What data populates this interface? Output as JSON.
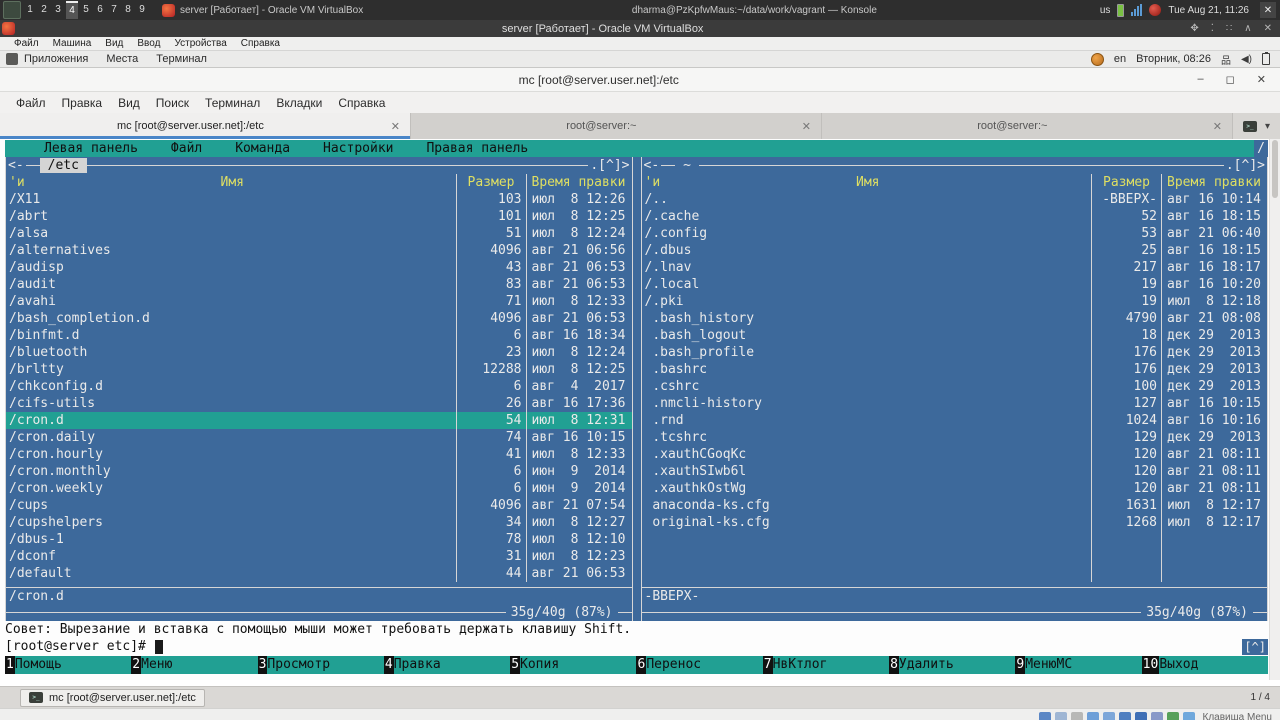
{
  "host_bar": {
    "workspaces": [
      {
        "n": "1"
      },
      {
        "n": "2"
      },
      {
        "n": "3"
      },
      {
        "n": "4",
        "active": true
      },
      {
        "n": "5"
      },
      {
        "n": "6"
      },
      {
        "n": "7"
      },
      {
        "n": "8"
      },
      {
        "n": "9"
      }
    ],
    "tasks": [
      {
        "label": "server [Работает] - Oracle VM VirtualBox"
      },
      {
        "label": "dharma@PzKpfwMaus:~/data/work/vagrant — Konsole"
      }
    ],
    "tray": {
      "layout": "us",
      "clock": "Tue Aug 21, 11:26",
      "close_glyph": "✕"
    }
  },
  "vbox": {
    "title": "server [Работает] - Oracle VM VirtualBox",
    "window_controls": [
      {
        "g": "✥"
      },
      {
        "g": "⁚"
      },
      {
        "g": "∷"
      },
      {
        "g": "∧"
      },
      {
        "g": "✕"
      }
    ],
    "menu": [
      {
        "label": "Файл"
      },
      {
        "label": "Машина"
      },
      {
        "label": "Вид"
      },
      {
        "label": "Ввод"
      },
      {
        "label": "Устройства"
      },
      {
        "label": "Справка"
      }
    ],
    "statusbar": {
      "icons": [
        {
          "name": "hdd",
          "color": "#5b87c5"
        },
        {
          "name": "cd",
          "color": "#9fb6d4"
        },
        {
          "name": "audio",
          "color": "#b8b8b6"
        },
        {
          "name": "network",
          "color": "#6d9fd8"
        },
        {
          "name": "usb",
          "color": "#7da7d9"
        },
        {
          "name": "shared-folders",
          "color": "#4f7fc0"
        },
        {
          "name": "display",
          "color": "#3f6fb5"
        },
        {
          "name": "recording",
          "color": "#8898c8"
        },
        {
          "name": "features",
          "color": "#57a05a"
        },
        {
          "name": "mouse",
          "color": "#6fa8dc"
        }
      ],
      "hostkey": "Клавиша Menu"
    }
  },
  "guest_panel": {
    "menus": [
      {
        "label": "Приложения"
      },
      {
        "label": "Места"
      },
      {
        "label": "Терминал"
      }
    ],
    "layout": "en",
    "clock": "Вторник, 08:26"
  },
  "terminal": {
    "title": "mc [root@server.user.net]:/etc",
    "controls": {
      "minimize": "–",
      "maximize": "◻",
      "close": "✕"
    },
    "menu": [
      {
        "label": "Файл"
      },
      {
        "label": "Правка"
      },
      {
        "label": "Вид"
      },
      {
        "label": "Поиск"
      },
      {
        "label": "Терминал"
      },
      {
        "label": "Вкладки"
      },
      {
        "label": "Справка"
      }
    ],
    "tabs": [
      {
        "label": "mc [root@server.user.net]:/etc",
        "close": "✕"
      },
      {
        "label": "root@server:~",
        "close": "✕"
      },
      {
        "label": "root@server:~",
        "close": "✕"
      }
    ],
    "new_tab_glyph": ">_",
    "tab_dropdown_glyph": "▾"
  },
  "mc": {
    "menubar": [
      {
        "label": "Левая панель"
      },
      {
        "label": "Файл"
      },
      {
        "label": "Команда"
      },
      {
        "label": "Настройки"
      },
      {
        "label": "Правая панель"
      }
    ],
    "spinner": "/",
    "columns": {
      "sort_indicator": "'и",
      "name": "Имя",
      "size": "Размер",
      "mtime": "Время правки"
    },
    "corner_left": "<-",
    "corner_right": ".[^]>",
    "left_panel": {
      "title": "/etc",
      "rows": [
        {
          "name": "/X11",
          "size": "103",
          "date": "июл  8 12:26"
        },
        {
          "name": "/abrt",
          "size": "101",
          "date": "июл  8 12:25"
        },
        {
          "name": "/alsa",
          "size": "51",
          "date": "июл  8 12:24"
        },
        {
          "name": "/alternatives",
          "size": "4096",
          "date": "авг 21 06:56"
        },
        {
          "name": "/audisp",
          "size": "43",
          "date": "авг 21 06:53"
        },
        {
          "name": "/audit",
          "size": "83",
          "date": "авг 21 06:53"
        },
        {
          "name": "/avahi",
          "size": "71",
          "date": "июл  8 12:33"
        },
        {
          "name": "/bash_completion.d",
          "size": "4096",
          "date": "авг 21 06:53"
        },
        {
          "name": "/binfmt.d",
          "size": "6",
          "date": "авг 16 18:34"
        },
        {
          "name": "/bluetooth",
          "size": "23",
          "date": "июл  8 12:24"
        },
        {
          "name": "/brltty",
          "size": "12288",
          "date": "июл  8 12:25"
        },
        {
          "name": "/chkconfig.d",
          "size": "6",
          "date": "авг  4  2017"
        },
        {
          "name": "/cifs-utils",
          "size": "26",
          "date": "авг 16 17:36"
        },
        {
          "name": "/cron.d",
          "size": "54",
          "date": "июл  8 12:31",
          "selected": true
        },
        {
          "name": "/cron.daily",
          "size": "74",
          "date": "авг 16 10:15"
        },
        {
          "name": "/cron.hourly",
          "size": "41",
          "date": "июл  8 12:33"
        },
        {
          "name": "/cron.monthly",
          "size": "6",
          "date": "июн  9  2014"
        },
        {
          "name": "/cron.weekly",
          "size": "6",
          "date": "июн  9  2014"
        },
        {
          "name": "/cups",
          "size": "4096",
          "date": "авг 21 07:54"
        },
        {
          "name": "/cupshelpers",
          "size": "34",
          "date": "июл  8 12:27"
        },
        {
          "name": "/dbus-1",
          "size": "78",
          "date": "июл  8 12:10"
        },
        {
          "name": "/dconf",
          "size": "31",
          "date": "июл  8 12:23"
        },
        {
          "name": "/default",
          "size": "44",
          "date": "авг 21 06:53"
        }
      ],
      "status": "/cron.d",
      "usage": "35g/40g (87%)"
    },
    "right_panel": {
      "title": "~",
      "rows": [
        {
          "name": "/..",
          "size": "-ВВЕРХ-",
          "date": "авг 16 10:14"
        },
        {
          "name": "/.cache",
          "size": "52",
          "date": "авг 16 18:15"
        },
        {
          "name": "/.config",
          "size": "53",
          "date": "авг 21 06:40"
        },
        {
          "name": "/.dbus",
          "size": "25",
          "date": "авг 16 18:15"
        },
        {
          "name": "/.lnav",
          "size": "217",
          "date": "авг 16 18:17"
        },
        {
          "name": "/.local",
          "size": "19",
          "date": "авг 16 10:20"
        },
        {
          "name": "/.pki",
          "size": "19",
          "date": "июл  8 12:18"
        },
        {
          "name": " .bash_history",
          "size": "4790",
          "date": "авг 21 08:08"
        },
        {
          "name": " .bash_logout",
          "size": "18",
          "date": "дек 29  2013"
        },
        {
          "name": " .bash_profile",
          "size": "176",
          "date": "дек 29  2013"
        },
        {
          "name": " .bashrc",
          "size": "176",
          "date": "дек 29  2013"
        },
        {
          "name": " .cshrc",
          "size": "100",
          "date": "дек 29  2013"
        },
        {
          "name": " .nmcli-history",
          "size": "127",
          "date": "авг 16 10:15"
        },
        {
          "name": " .rnd",
          "size": "1024",
          "date": "авг 16 10:16"
        },
        {
          "name": " .tcshrc",
          "size": "129",
          "date": "дек 29  2013"
        },
        {
          "name": " .xauthCGoqKc",
          "size": "120",
          "date": "авг 21 08:11"
        },
        {
          "name": " .xauthSIwb6l",
          "size": "120",
          "date": "авг 21 08:11"
        },
        {
          "name": " .xauthkOstWg",
          "size": "120",
          "date": "авг 21 08:11"
        },
        {
          "name": " anaconda-ks.cfg",
          "size": "1631",
          "date": "июл  8 12:17"
        },
        {
          "name": " original-ks.cfg",
          "size": "1268",
          "date": "июл  8 12:17"
        }
      ],
      "status": "-ВВЕРХ-",
      "usage": "35g/40g (87%)"
    },
    "hint": "Совет: Вырезание и вставка с помощью мыши может требовать держать клавишу Shift.",
    "prompt": "[root@server etc]# ",
    "scroll_up": "[^]",
    "fkeys": [
      {
        "n": "1",
        "label": "Помощь"
      },
      {
        "n": "2",
        "label": "Меню"
      },
      {
        "n": "3",
        "label": "Просмотр"
      },
      {
        "n": "4",
        "label": "Правка"
      },
      {
        "n": "5",
        "label": "Копия"
      },
      {
        "n": "6",
        "label": "Перенос"
      },
      {
        "n": "7",
        "label": "НвКтлог"
      },
      {
        "n": "8",
        "label": "Удалить"
      },
      {
        "n": "9",
        "label": "МенюМС"
      },
      {
        "n": "10",
        "label": "Выход"
      }
    ]
  },
  "guest_taskbar": {
    "window_button": "mc [root@server.user.net]:/etc",
    "pager": "1 / 4"
  }
}
